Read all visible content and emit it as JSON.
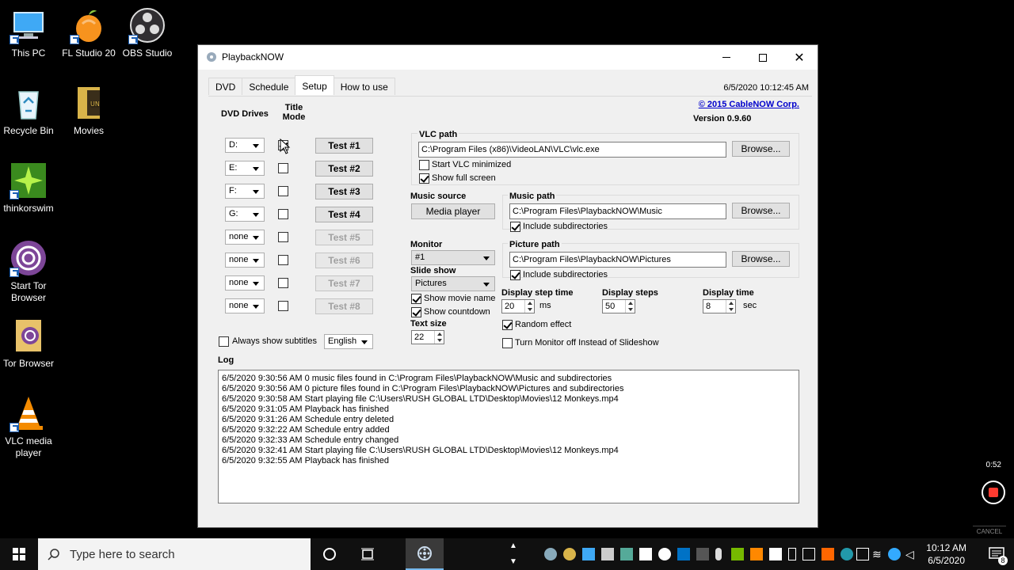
{
  "desktop": {
    "icons": [
      {
        "label": "This PC"
      },
      {
        "label": "FL Studio 20"
      },
      {
        "label": "OBS Studio"
      },
      {
        "label": "Recycle Bin"
      },
      {
        "label": "Movies"
      },
      {
        "label": "thinkorswim"
      },
      {
        "label": "Start Tor Browser"
      },
      {
        "label": "Tor Browser"
      },
      {
        "label": "VLC media player"
      }
    ],
    "recorder_time": "0:52",
    "recorder_cancel": "CANCEL"
  },
  "window": {
    "title": "PlaybackNOW",
    "datetime": "6/5/2020 10:12:45 AM",
    "tabs": [
      "DVD",
      "Schedule",
      "Setup",
      "How to use"
    ],
    "active_tab": "Setup",
    "copyright": "© 2015 CableNOW Corp.",
    "version": "Version 0.9.60"
  },
  "setup": {
    "dvd_drives_label": "DVD Drives",
    "title_mode_label": "Title Mode",
    "drives": [
      {
        "drive": "D:",
        "title_mode": true,
        "test": "Test #1",
        "enabled": true
      },
      {
        "drive": "E:",
        "title_mode": false,
        "test": "Test #2",
        "enabled": true
      },
      {
        "drive": "F:",
        "title_mode": false,
        "test": "Test #3",
        "enabled": true
      },
      {
        "drive": "G:",
        "title_mode": false,
        "test": "Test #4",
        "enabled": true
      },
      {
        "drive": "none",
        "title_mode": false,
        "test": "Test #5",
        "enabled": false
      },
      {
        "drive": "none",
        "title_mode": false,
        "test": "Test #6",
        "enabled": false
      },
      {
        "drive": "none",
        "title_mode": false,
        "test": "Test #7",
        "enabled": false
      },
      {
        "drive": "none",
        "title_mode": false,
        "test": "Test #8",
        "enabled": false
      }
    ],
    "always_show_subtitles": "Always show subtitles",
    "language": "English",
    "vlc_path_label": "VLC path",
    "vlc_path": "C:\\Program Files (x86)\\VideoLAN\\VLC\\vlc.exe",
    "browse": "Browse...",
    "start_vlc_minimized": "Start VLC minimized",
    "show_full_screen": "Show full screen",
    "music_source_label": "Music source",
    "music_source": "Media player",
    "music_path_label": "Music path",
    "music_path": "C:\\Program Files\\PlaybackNOW\\Music",
    "include_subdirectories": "Include subdirectories",
    "monitor_label": "Monitor",
    "monitor": "#1",
    "slide_show_label": "Slide show",
    "slide_show": "Pictures",
    "show_movie_name": "Show movie name",
    "show_countdown": "Show countdown",
    "text_size_label": "Text size",
    "text_size": "22",
    "picture_path_label": "Picture path",
    "picture_path": "C:\\Program Files\\PlaybackNOW\\Pictures",
    "display_step_time_label": "Display step time",
    "display_step_time": "20",
    "ms": "ms",
    "display_steps_label": "Display steps",
    "display_steps": "50",
    "display_time_label": "Display time",
    "display_time": "8",
    "sec": "sec",
    "random_effect": "Random effect",
    "turn_monitor_off": "Turn Monitor off Instead of Slideshow",
    "log_label": "Log",
    "log": [
      "6/5/2020 9:30:56 AM 0 music files found in C:\\Program Files\\PlaybackNOW\\Music and subdirectories",
      "6/5/2020 9:30:56 AM 0 picture files found in C:\\Program Files\\PlaybackNOW\\Pictures and subdirectories",
      "6/5/2020 9:30:58 AM Start playing file C:\\Users\\RUSH GLOBAL LTD\\Desktop\\Movies\\12 Monkeys.mp4",
      "6/5/2020 9:31:05 AM Playback has finished",
      "6/5/2020 9:31:26 AM Schedule entry deleted",
      "6/5/2020 9:32:22 AM Schedule entry added",
      "6/5/2020 9:32:33 AM Schedule entry changed",
      "6/5/2020 9:32:41 AM Start playing file C:\\Users\\RUSH GLOBAL LTD\\Desktop\\Movies\\12 Monkeys.mp4",
      "6/5/2020 9:32:55 AM Playback has finished"
    ]
  },
  "taskbar": {
    "search_placeholder": "Type here to search",
    "time": "10:12 AM",
    "date": "6/5/2020",
    "notification_count": "8"
  }
}
